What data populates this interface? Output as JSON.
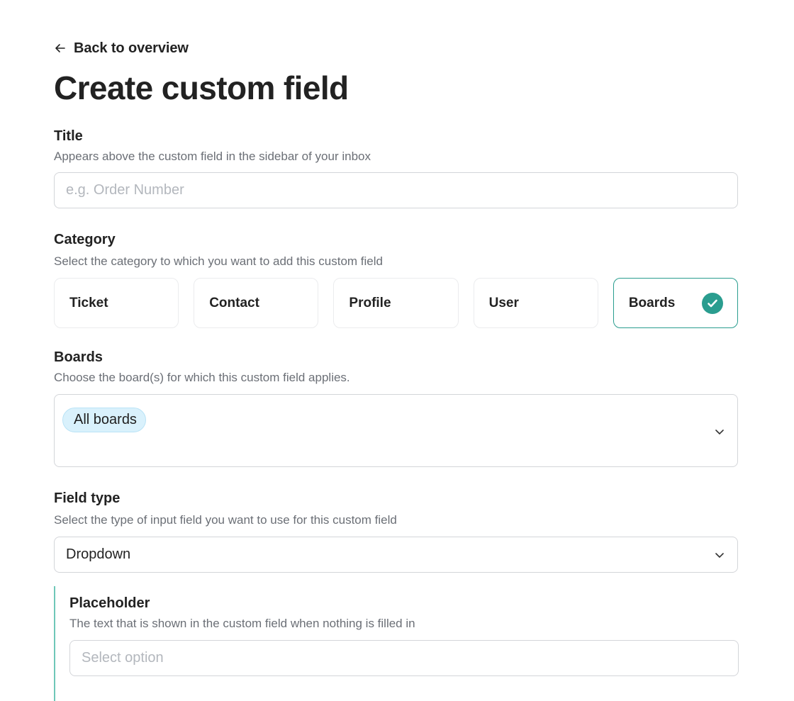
{
  "nav": {
    "back_label": "Back to overview"
  },
  "page": {
    "title": "Create custom field"
  },
  "title_field": {
    "label": "Title",
    "help": "Appears above the custom field in the sidebar of your inbox",
    "placeholder": "e.g. Order Number"
  },
  "category": {
    "label": "Category",
    "help": "Select the category to which you want to add this custom field",
    "options": [
      "Ticket",
      "Contact",
      "Profile",
      "User",
      "Boards"
    ],
    "selected": "Boards"
  },
  "boards": {
    "label": "Boards",
    "help": "Choose the board(s) for which this custom field applies.",
    "chips": [
      "All boards"
    ]
  },
  "field_type": {
    "label": "Field type",
    "help": "Select the type of input field you want to use for this custom field",
    "value": "Dropdown"
  },
  "placeholder_field": {
    "label": "Placeholder",
    "help": "The text that is shown in the custom field when nothing is filled in",
    "placeholder": "Select option"
  },
  "colors": {
    "accent": "#2a9d8f",
    "chip_bg": "#d9f1fc",
    "muted_text": "#6b6f76"
  },
  "icons": [
    "arrow-left-icon",
    "check-circle-icon",
    "chevron-down-icon"
  ]
}
